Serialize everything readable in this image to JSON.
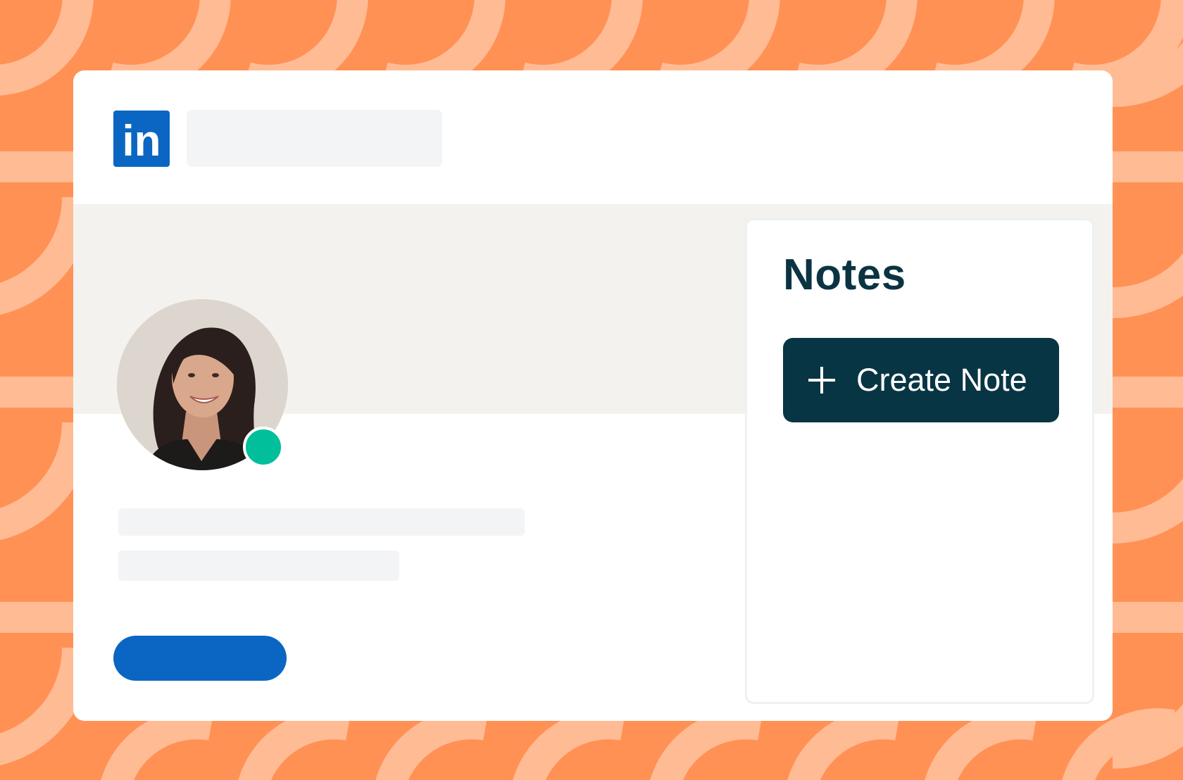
{
  "colors": {
    "background": "#ff9155",
    "pattern_light": "#ffbb94",
    "card": "#ffffff",
    "linkedin_blue": "#0a66c2",
    "banner": "#f3f2ef",
    "placeholder": "#f3f4f6",
    "status_online": "#00bf9a",
    "notes_title": "#0b3442",
    "create_button": "#083543"
  },
  "header": {
    "logo_icon": "linkedin-logo-icon",
    "logo_text": "in"
  },
  "profile": {
    "avatar_icon": "profile-photo",
    "status": "online"
  },
  "notes": {
    "title": "Notes",
    "create_button": {
      "icon": "plus-icon",
      "label": "Create Note"
    }
  }
}
